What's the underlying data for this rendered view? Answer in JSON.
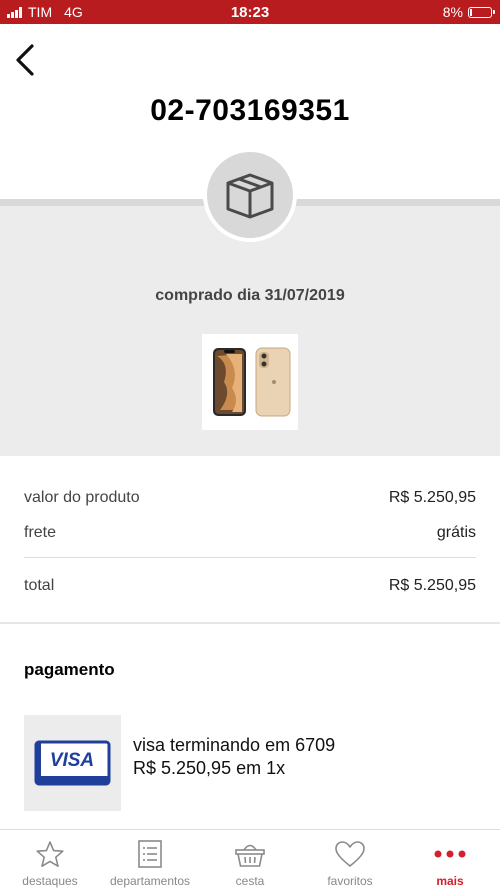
{
  "status_bar": {
    "carrier": "TIM",
    "network": "4G",
    "time": "18:23",
    "battery": "8%",
    "battery_level": 0.08
  },
  "order": {
    "number": "02-703169351",
    "purchase_date": "comprado dia 31/07/2019"
  },
  "summary": {
    "product_value_label": "valor do produto",
    "product_value": "R$ 5.250,95",
    "shipping_label": "frete",
    "shipping_value": "grátis",
    "total_label": "total",
    "total_value": "R$ 5.250,95"
  },
  "payment": {
    "heading": "pagamento",
    "card_brand": "VISA",
    "card_line": "visa terminando em 6709",
    "installments_line": "R$ 5.250,95 em 1x"
  },
  "bottom_nav": {
    "items": [
      {
        "label": "destaques",
        "icon": "star-icon"
      },
      {
        "label": "departamentos",
        "icon": "list-icon"
      },
      {
        "label": "cesta",
        "icon": "basket-icon"
      },
      {
        "label": "favoritos",
        "icon": "heart-icon"
      },
      {
        "label": "mais",
        "icon": "more-dots-icon",
        "active": true
      }
    ]
  },
  "colors": {
    "brand_red": "#b81c1f",
    "active_red": "#d3202a"
  }
}
